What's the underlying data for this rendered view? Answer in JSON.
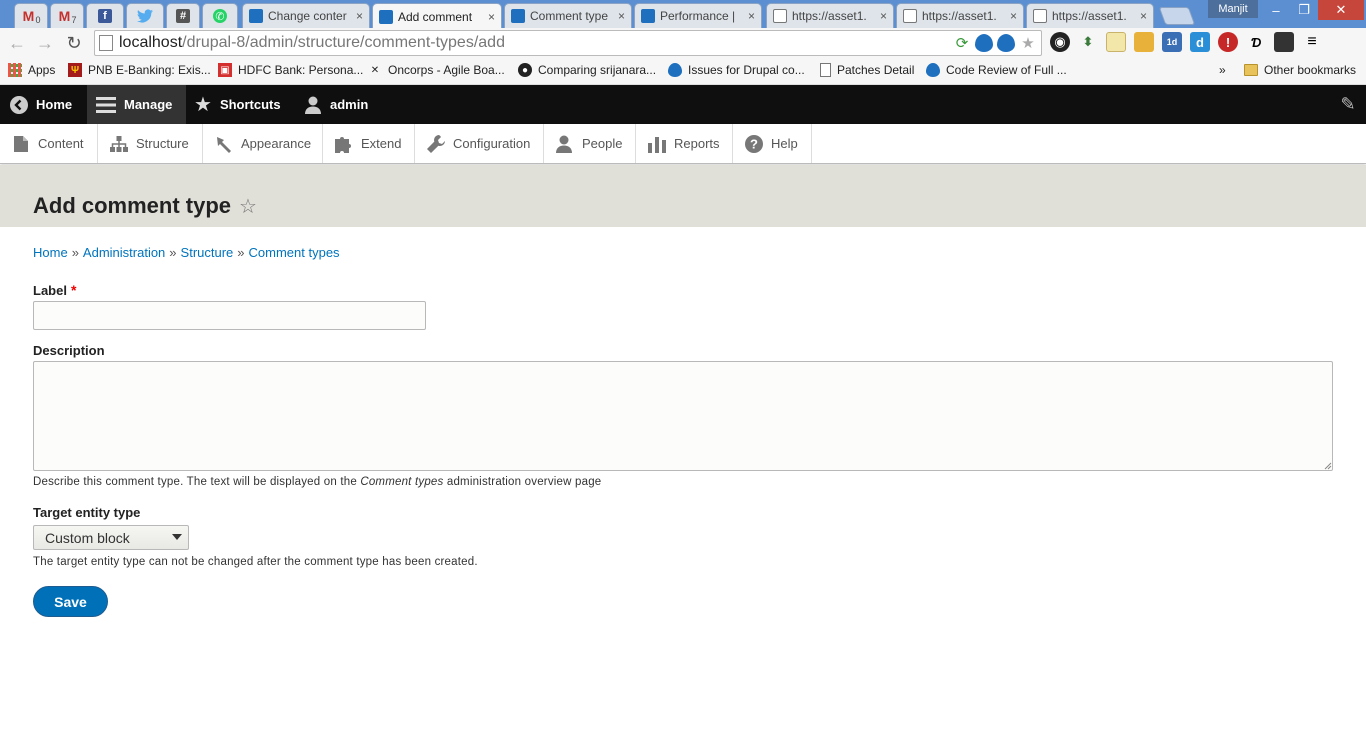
{
  "browser": {
    "pinned_tabs": [
      {
        "icon": "gmail-icon",
        "badge": "0"
      },
      {
        "icon": "gmail-icon",
        "badge": "7"
      },
      {
        "icon": "facebook-icon",
        "badge": ""
      },
      {
        "icon": "twitter-icon",
        "badge": ""
      },
      {
        "icon": "slack-icon",
        "badge": ""
      },
      {
        "icon": "whatsapp-icon",
        "badge": ""
      }
    ],
    "tabs": [
      {
        "title": "Change conter",
        "close": "×",
        "icon": "drupal"
      },
      {
        "title": "Add comment",
        "close": "×",
        "icon": "drupal"
      },
      {
        "title": "Comment type",
        "close": "×",
        "icon": "drupal"
      },
      {
        "title": "Performance |",
        "close": "×",
        "icon": "drupal"
      },
      {
        "title": "https://asset1.",
        "close": "×",
        "icon": "page"
      },
      {
        "title": "https://asset1.",
        "close": "×",
        "icon": "page"
      },
      {
        "title": "https://asset1.",
        "close": "×",
        "icon": "page"
      }
    ],
    "user_name": "Manjit",
    "url_host": "localhost",
    "url_path": "/drupal-8/admin/structure/comment-types/add",
    "bookmarks": [
      {
        "label": "Apps",
        "icon": "apps-icon"
      },
      {
        "label": "PNB E-Banking: Exis...",
        "icon": "pnb-icon"
      },
      {
        "label": "HDFC Bank: Persona...",
        "icon": "hdfc-icon"
      },
      {
        "label": "Oncorps - Agile Boa...",
        "icon": "oncorps-icon"
      },
      {
        "label": "Comparing srijanara...",
        "icon": "github-icon"
      },
      {
        "label": "Issues for Drupal co...",
        "icon": "drupal-icon"
      },
      {
        "label": "Patches Detail",
        "icon": "page-icon"
      },
      {
        "label": "Code Review of Full ...",
        "icon": "drupal-icon"
      }
    ],
    "bookmarks_overflow": "»",
    "other_bookmarks": "Other bookmarks"
  },
  "admin_toolbar": {
    "home": "Home",
    "manage": "Manage",
    "shortcuts": "Shortcuts",
    "user": "admin"
  },
  "admin_tray": [
    {
      "label": "Content",
      "icon": "content-icon"
    },
    {
      "label": "Structure",
      "icon": "structure-icon"
    },
    {
      "label": "Appearance",
      "icon": "appearance-icon"
    },
    {
      "label": "Extend",
      "icon": "extend-icon"
    },
    {
      "label": "Configuration",
      "icon": "configuration-icon"
    },
    {
      "label": "People",
      "icon": "people-icon"
    },
    {
      "label": "Reports",
      "icon": "reports-icon"
    },
    {
      "label": "Help",
      "icon": "help-icon"
    }
  ],
  "page": {
    "title": "Add comment type",
    "breadcrumb": [
      "Home",
      "Administration",
      "Structure",
      "Comment types"
    ],
    "breadcrumb_sep": "»"
  },
  "form": {
    "label_title": "Label",
    "label_required": "*",
    "label_value": "",
    "description_title": "Description",
    "description_value": "",
    "description_help_pre": "Describe this comment type. The text will be displayed on the ",
    "description_help_em": "Comment types",
    "description_help_post": " administration overview page",
    "target_title": "Target entity type",
    "target_selected": "Custom block",
    "target_help": "The target entity type can not be changed after the comment type has been created.",
    "save_label": "Save"
  },
  "colors": {
    "link": "#0074bd",
    "primary_button": "#0071b8",
    "toolbar_bg": "#0f0f0f",
    "header_bg": "#e0e0d8",
    "required": "#ee0000"
  }
}
